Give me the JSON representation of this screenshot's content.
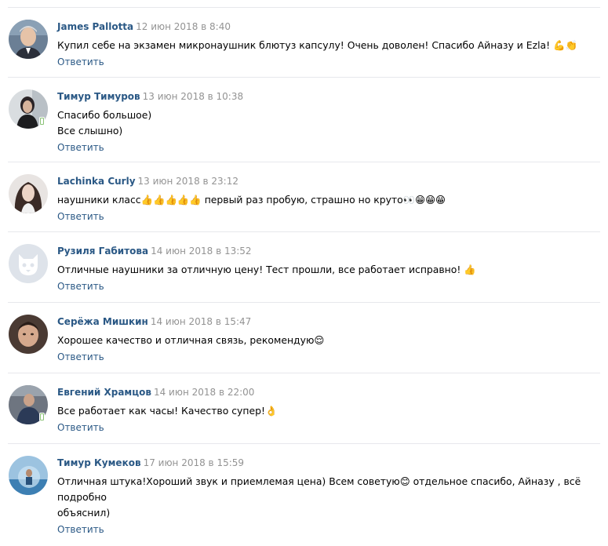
{
  "comments": [
    {
      "author": "James Pallotta",
      "date": "12 июн 2018 в 8:40",
      "lines": [
        "Купил себе на экзамен микронаушник блютуз капсулу! Очень доволен! Спасибо Айназу и Ezla! 💪👏"
      ],
      "reply": "Ответить",
      "avatar": "man-grey-hair-portrait",
      "online": false
    },
    {
      "author": "Тимур Тимуров",
      "date": "13 июн 2018 в 10:38",
      "lines": [
        "Спасибо большое)",
        "Все слышно)"
      ],
      "reply": "Ответить",
      "avatar": "woman-dark-hair-portrait",
      "online": true
    },
    {
      "author": "Lachinka Curly",
      "date": "13 июн 2018 в 23:12",
      "lines": [
        "наушники класс👍👍👍👍👍 первый раз пробую, страшно но круто👀😁😁😁"
      ],
      "reply": "Ответить",
      "avatar": "woman-long-hair-portrait",
      "online": false
    },
    {
      "author": "Рузиля Габитова",
      "date": "14 июн 2018 в 13:52",
      "lines": [
        "Отличные наушники за отличную цену! Тест прошли, все работает исправно! 👍"
      ],
      "reply": "Ответить",
      "avatar": "default-dog-avatar",
      "online": false
    },
    {
      "author": "Серёжа Мишкин",
      "date": "14 июн 2018 в 15:47",
      "lines": [
        "Хорошее качество и отличная связь, рекомендую😌"
      ],
      "reply": "Ответить",
      "avatar": "young-man-portrait",
      "online": false
    },
    {
      "author": "Евгений Храмцов",
      "date": "14 июн 2018 в 22:00",
      "lines": [
        "Все работает как часы! Качество супер!👌"
      ],
      "reply": "Ответить",
      "avatar": "man-in-gym-portrait",
      "online": true
    },
    {
      "author": "Тимур Кумеков",
      "date": "17 июн 2018 в 15:59",
      "lines": [
        "Отличная штука!Хороший звук и приемлемая цена) Всем советую😊 отдельное спасибо, Айназу , всё подробно",
        "объяснил)"
      ],
      "reply": "Ответить",
      "avatar": "man-at-sea-portrait",
      "online": false
    }
  ],
  "colors": {
    "author": "#2a5885",
    "date": "#939393",
    "divider": "#e7e8ec",
    "online": "#8ac176"
  }
}
